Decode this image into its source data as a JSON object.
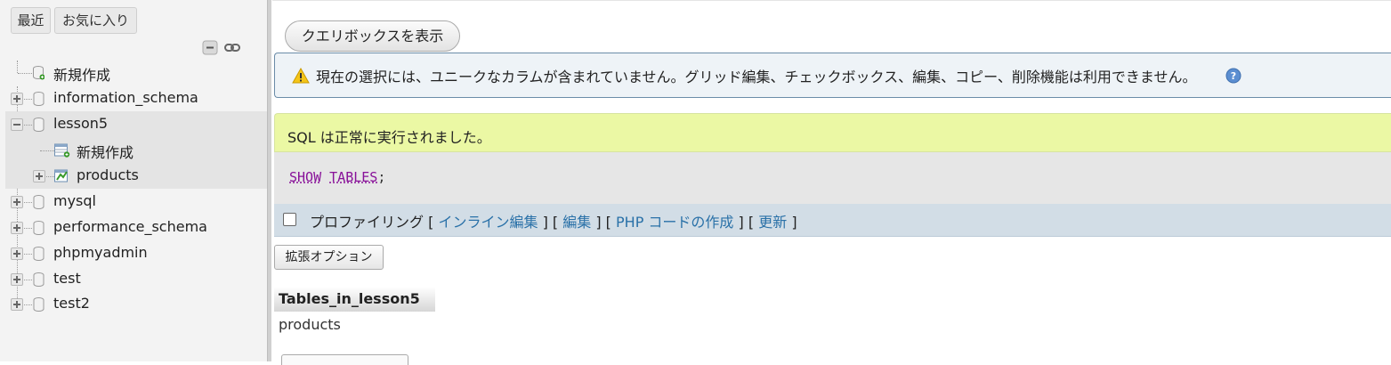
{
  "sidebar": {
    "tab_recent": "最近",
    "tab_favorites": "お気に入り",
    "tree": [
      {
        "label": "新規作成"
      },
      {
        "label": "information_schema"
      },
      {
        "label": "lesson5"
      },
      {
        "label": "新規作成"
      },
      {
        "label": "products"
      },
      {
        "label": "mysql"
      },
      {
        "label": "performance_schema"
      },
      {
        "label": "phpmyadmin"
      },
      {
        "label": "test"
      },
      {
        "label": "test2"
      }
    ]
  },
  "main": {
    "show_query_box_label": "クエリボックスを表示",
    "notice_text": "現在の選択には、ユニークなカラムが含まれていません。グリッド編集、チェックボックス、編集、コピー、削除機能は利用できません。",
    "success_text": "SQL は正常に実行されました。",
    "sql": {
      "kw1": "SHOW",
      "kw2": "TABLES",
      "end": ";"
    },
    "profiling": {
      "label": "プロファイリング",
      "bracket_open": "[",
      "bracket_sep": "] [",
      "bracket_close": "]",
      "inline_edit": "インライン編集",
      "edit": "編集",
      "create_php": "PHP コードの作成",
      "refresh": "更新"
    },
    "extended_options_label": "拡張オプション",
    "result": {
      "header": "Tables_in_lesson5",
      "rows": [
        "products"
      ]
    }
  },
  "colors": {
    "notice_bg": "#eef3f7",
    "success_bg": "#ebf8a4",
    "link": "#2a71a8",
    "sql_keyword": "#881199"
  }
}
